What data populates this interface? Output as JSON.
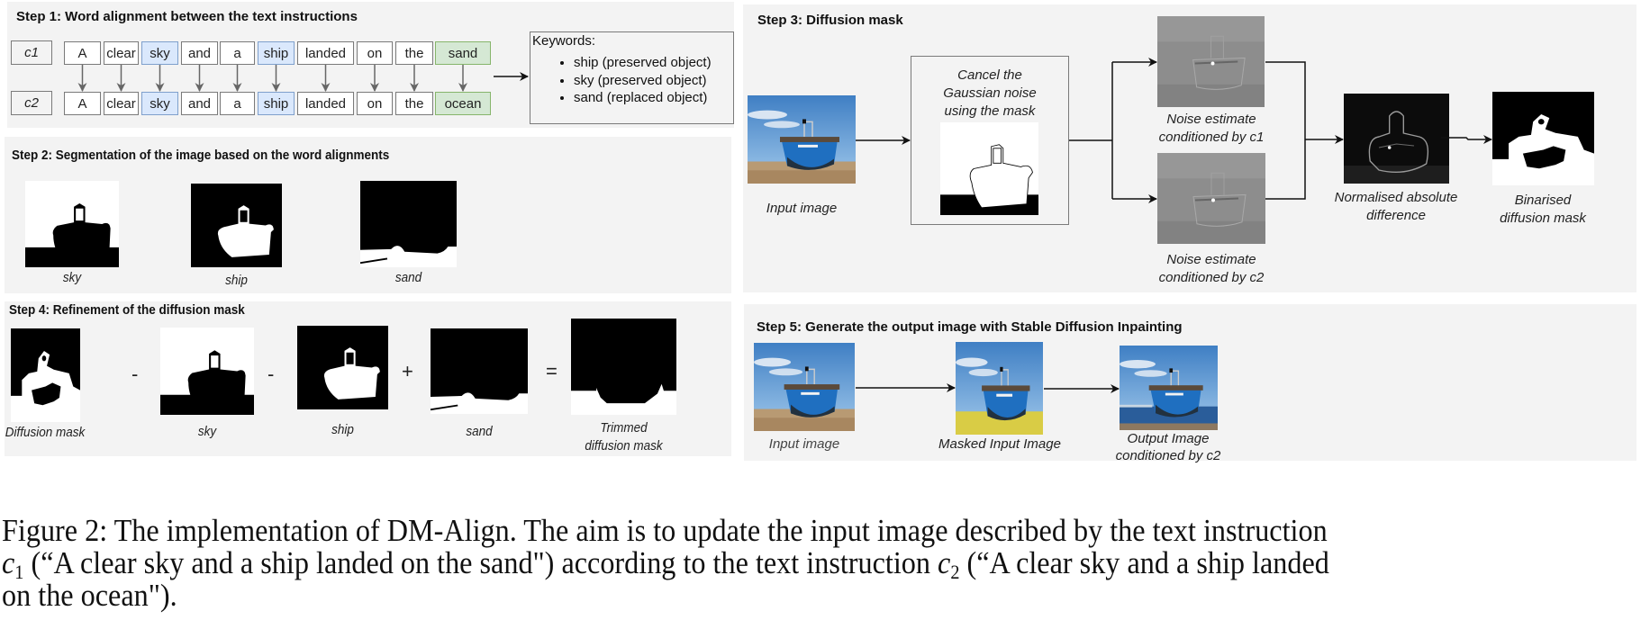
{
  "step1": {
    "title": "Step 1: Word alignment between the text instructions",
    "c1_label": "c1",
    "c2_label": "c2",
    "c1_words": [
      "A",
      "clear",
      "sky",
      "and",
      "a",
      "ship",
      "landed",
      "on",
      "the",
      "sand"
    ],
    "c2_words": [
      "A",
      "clear",
      "sky",
      "and",
      "a",
      "ship",
      "landed",
      "on",
      "the",
      "ocean"
    ],
    "word_highlight": [
      "none",
      "none",
      "preserved",
      "none",
      "none",
      "preserved",
      "none",
      "none",
      "none",
      "replaced"
    ],
    "keywords_title": "Keywords:",
    "keywords": [
      "ship (preserved object)",
      "sky (preserved object)",
      "sand (replaced object)"
    ],
    "colors": {
      "preserved_fill": "#dae8fc",
      "preserved_border": "#7fa0cc",
      "replaced_fill": "#d5e8d4",
      "replaced_border": "#86b56b"
    }
  },
  "step2": {
    "title": "Step 2: Segmentation of the image based on the word alignments",
    "masks": [
      {
        "label": "sky",
        "image": "sky-mask"
      },
      {
        "label": "ship",
        "image": "ship-mask"
      },
      {
        "label": "sand",
        "image": "sand-mask"
      }
    ]
  },
  "step3": {
    "title": "Step 3: Diffusion mask",
    "input_label": "Input image",
    "cancel_text": "Cancel the Gaussian noise using the mask",
    "cancel_lines": [
      "Cancel the",
      "Gaussian noise",
      "using the mask"
    ],
    "noise1_label": [
      "Noise estimate",
      "conditioned by c1"
    ],
    "noise2_label": [
      "Noise estimate",
      "conditioned by c2"
    ],
    "difference_label": [
      "Normalised absolute",
      "difference"
    ],
    "binarised_label": [
      "Binarised",
      "diffusion mask"
    ]
  },
  "step4": {
    "title": "Step 4: Refinement of the diffusion mask",
    "terms": [
      {
        "label": "Diffusion mask",
        "image": "diffusion-mask"
      },
      {
        "label": "sky",
        "image": "sky-mask"
      },
      {
        "label": "ship",
        "image": "ship-mask"
      },
      {
        "label": "sand",
        "image": "sand-mask"
      },
      {
        "label": "Trimmed diffusion mask",
        "image": "trimmed-mask"
      }
    ],
    "operators": [
      "-",
      "-",
      "+",
      "="
    ],
    "trimmed_lines": [
      "Trimmed",
      "diffusion mask"
    ]
  },
  "step5": {
    "title": "Step 5: Generate the output image with Stable Diffusion Inpainting",
    "input_label": "Input image",
    "masked_label": "Masked Input Image",
    "output_label": [
      "Output Image",
      "conditioned by c2"
    ]
  },
  "caption": {
    "line1": "Figure 2: The implementation of DM-Align. The aim is to update the input image described by the text instruction",
    "line2_c1": "c",
    "line2_c1_sub": "1",
    "line2_mid": " (“A clear sky and a ship landed on the sand\") according to the text instruction ",
    "line2_c2": "c",
    "line2_c2_sub": "2",
    "line2_end": " (“A clear sky and a ship landed",
    "line3": "on the ocean\")."
  }
}
